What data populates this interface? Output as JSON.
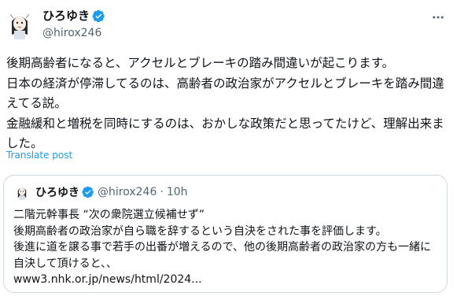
{
  "tweet": {
    "author": {
      "display_name": "ひろゆき",
      "handle": "@hirox246",
      "verified_icon": "verified-badge-icon",
      "verified_color": "#1d9bf0"
    },
    "more_icon": "more-dots-icon",
    "text": "後期高齢者になると、アクセルとブレーキの踏み間違いが起こります。\n日本の経済が停滞してるのは、高齢者の政治家がアクセルとブレーキを踏み間違えてる説。\n金融緩和と増税を同時にするのは、おかしな政策だと思ってたけど、理解出来ました。",
    "translate_label": "Translate post",
    "link_color": "#1d9bf0"
  },
  "quoted": {
    "display_name": "ひろゆき",
    "handle": "@hirox246",
    "separator": "·",
    "time": "10h",
    "text": "二階元幹事長 “次の衆院選立候補せず”\n後期高齢者の政治家が自ら職を辞するという自決をされた事を評価します。\n後進に道を譲る事で若手の出番が増えるので、他の後期高齢者の政治家の方も一緒に自決して頂けると、、\nwww3.nhk.or.jp/news/html/2024..."
  }
}
